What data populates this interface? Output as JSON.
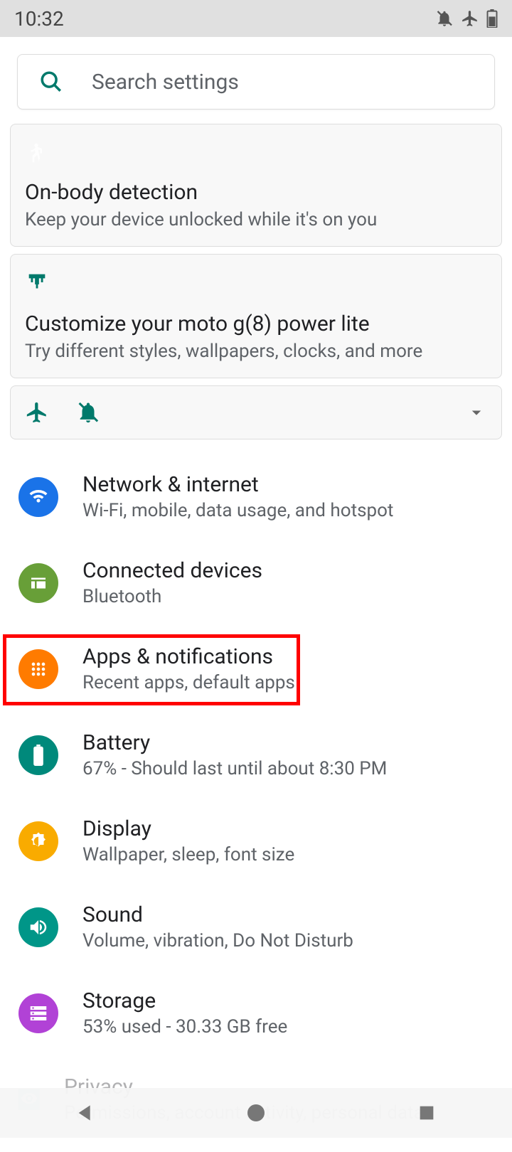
{
  "status": {
    "time": "10:32"
  },
  "search": {
    "placeholder": "Search settings"
  },
  "suggestion1": {
    "title": "On-body detection",
    "subtitle": "Keep your device unlocked while it's on you"
  },
  "suggestion2": {
    "title": "Customize your moto g(8) power lite",
    "subtitle": "Try different styles, wallpapers, clocks, and more"
  },
  "items": {
    "network": {
      "title": "Network & internet",
      "sub": "Wi-Fi, mobile, data usage, and hotspot"
    },
    "connected": {
      "title": "Connected devices",
      "sub": "Bluetooth"
    },
    "apps": {
      "title": "Apps & notifications",
      "sub": "Recent apps, default apps"
    },
    "battery": {
      "title": "Battery",
      "sub": "67% - Should last until about 8:30 PM"
    },
    "display": {
      "title": "Display",
      "sub": "Wallpaper, sleep, font size"
    },
    "sound": {
      "title": "Sound",
      "sub": "Volume, vibration, Do Not Disturb"
    },
    "storage": {
      "title": "Storage",
      "sub": "53% used - 30.33 GB free"
    },
    "privacy": {
      "title": "Privacy",
      "sub": "Permissions, account activity, personal data"
    }
  },
  "colors": {
    "teal": "#00796b",
    "blue": "#1a73e8",
    "green": "#689f38",
    "orange": "#ff7b00",
    "tealdark": "#00897b",
    "amber": "#f9ab00",
    "tealcircle": "#009688",
    "purple": "#b142d6"
  }
}
